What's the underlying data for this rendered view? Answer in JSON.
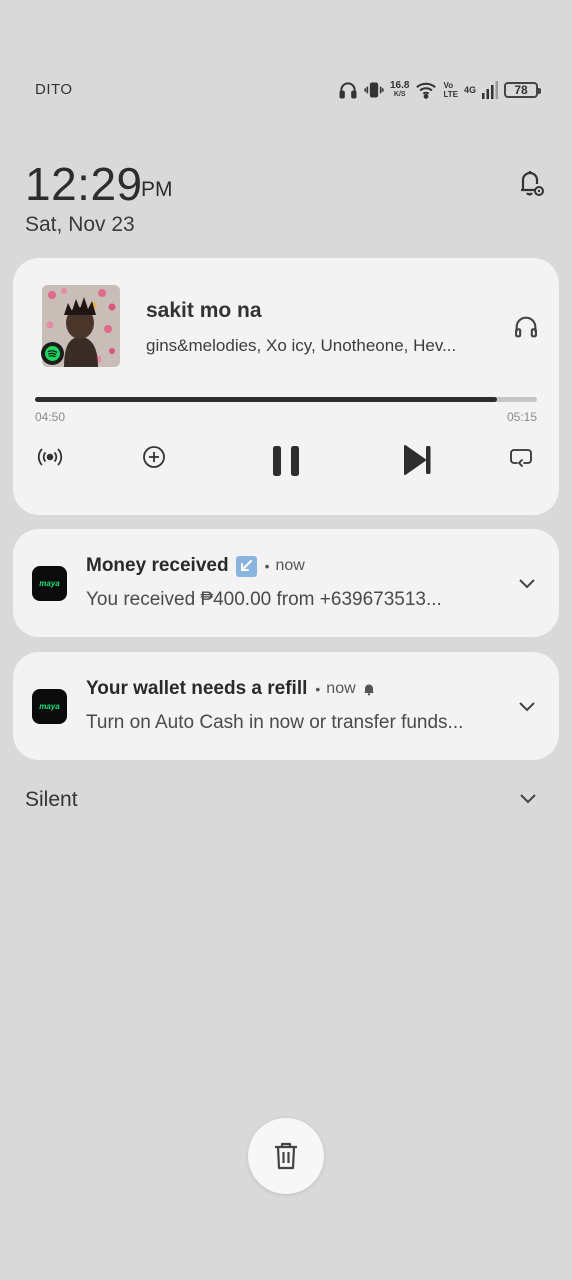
{
  "status_bar": {
    "carrier": "DITO",
    "speed_value": "16.8",
    "speed_unit": "K/S",
    "volte_top": "Vo",
    "volte_bottom": "LTE",
    "network": "4G",
    "battery": "78",
    "icons": [
      "headphones-icon",
      "vibrate-icon",
      "wifi-icon",
      "signal-icon",
      "battery-icon"
    ]
  },
  "header": {
    "time": "12:29",
    "ampm": "PM",
    "date": "Sat, Nov 23",
    "settings_icon": "notification-settings-icon"
  },
  "media": {
    "title": "sakit mo na",
    "artist": "gins&melodies, Xo icy, Unotheone, Hev...",
    "elapsed": "04:50",
    "total": "05:15",
    "progress": 0.92,
    "app_badge": "spotify-icon",
    "controls": [
      "broadcast-icon",
      "add-icon",
      "pause-icon",
      "skip-next-icon",
      "repeat-icon"
    ]
  },
  "notifications": [
    {
      "app": "maya",
      "title": "Money received",
      "time": "now",
      "body": "You received ₱400.00 from +639673513...",
      "emoji": "incoming-arrow-icon"
    },
    {
      "app": "maya",
      "title": "Your wallet needs a refill",
      "time": "now",
      "body": "Turn on Auto Cash in now or transfer funds...",
      "emoji": "bell-icon"
    }
  ],
  "silent": {
    "label": "Silent"
  },
  "colors": {
    "background": "#d9d9d9",
    "card": "#f3f3f3",
    "maya_green": "#1ee37a",
    "spotify_green": "#1ed760"
  }
}
